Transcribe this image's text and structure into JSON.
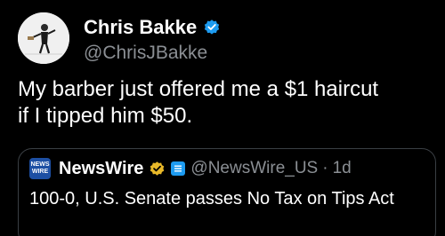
{
  "author": {
    "display_name": "Chris Bakke",
    "handle": "@ChrisJBakke",
    "avatar_icon": "cartoon-man-avatar-icon",
    "verified_icon": "blue-verified-badge-icon"
  },
  "tweet": {
    "text": "My barber just offered me a $1 haircut\nif I tipped him $50."
  },
  "quoted_tweet": {
    "logo_text_line1": "NEWS",
    "logo_text_line2": "WIRE",
    "display_name": "NewsWire",
    "handle": "@NewsWire_US",
    "separator": "·",
    "time": "1d",
    "text": "100-0, U.S. Senate passes No Tax on Tips Act",
    "gold_badge_icon": "gold-verified-badge-icon",
    "affiliate_badge_icon": "affiliate-badge-icon"
  },
  "colors": {
    "background": "#000000",
    "text": "#ffffff",
    "secondary_text": "#8b8f94",
    "verified_blue": "#1d9bf0",
    "verified_gold": "#e8b829",
    "border": "#3a3f44"
  }
}
